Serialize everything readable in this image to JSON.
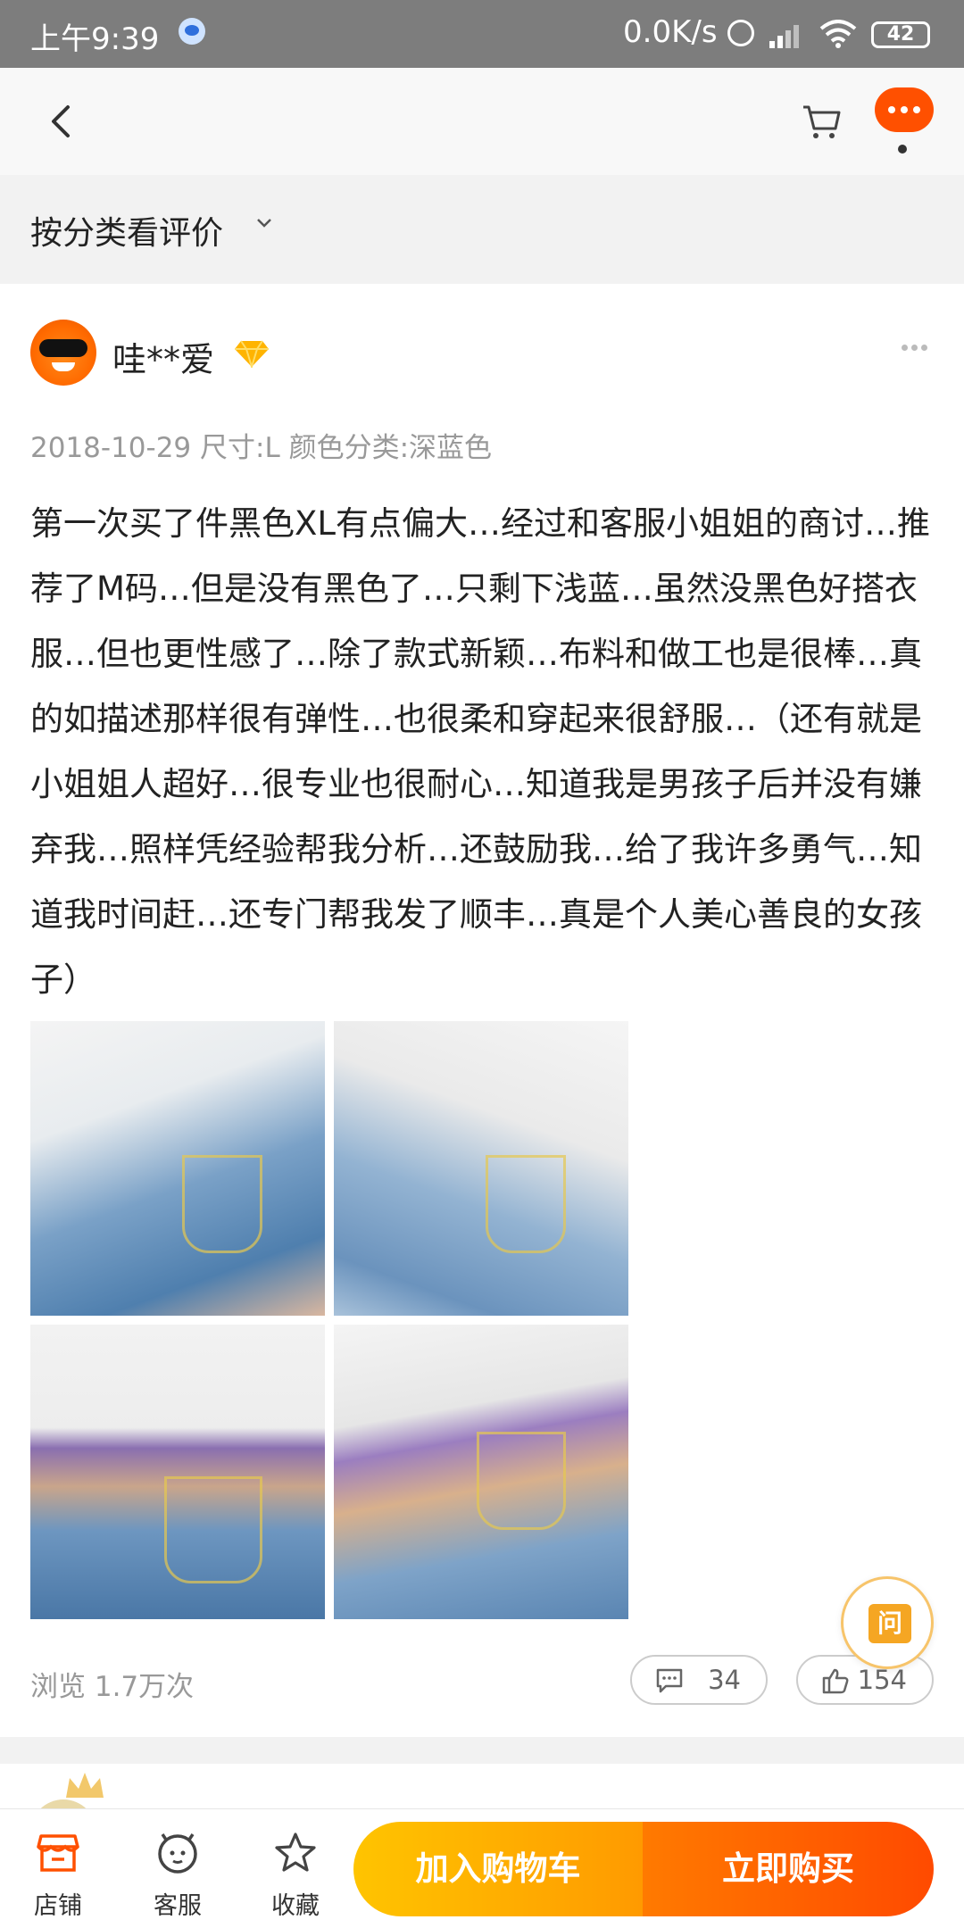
{
  "status_bar": {
    "time": "上午9:39",
    "net_speed": "0.0K/s",
    "battery": "42"
  },
  "header": {
    "back_icon": "chevron-left-icon",
    "cart_icon": "cart-icon",
    "more_icon": "more-dots-icon",
    "accent": "#ff5000"
  },
  "filter": {
    "label": "按分类看评价"
  },
  "review": {
    "username": "哇**爱",
    "meta": "2018-10-29 尺寸:L 颜色分类:深蓝色",
    "text": "第一次买了件黑色XL有点偏大…经过和客服小姐姐的商讨…推荐了M码…但是没有黑色了…只剩下浅蓝…虽然没黑色好搭衣服…但也更性感了…除了款式新颖…布料和做工也是很棒…真的如描述那样很有弹性…也很柔和穿起来很舒服…（还有就是小姐姐人超好…很专业也很耐心…知道我是男孩子后并没有嫌弃我…照样凭经验帮我分析…还鼓励我…给了我许多勇气…知道我时间赶…还专门帮我发了顺丰…真是个人美心善良的女孩子）",
    "views": "浏览 1.7万次",
    "comments": "34",
    "likes": "154",
    "ask_label": "问"
  },
  "bottom_bar": {
    "store": "店铺",
    "service": "客服",
    "favorite": "收藏",
    "add_to_cart": "加入购物车",
    "buy_now": "立即购买",
    "cart_color": "#ffb000",
    "buy_color": "#ff5000"
  }
}
